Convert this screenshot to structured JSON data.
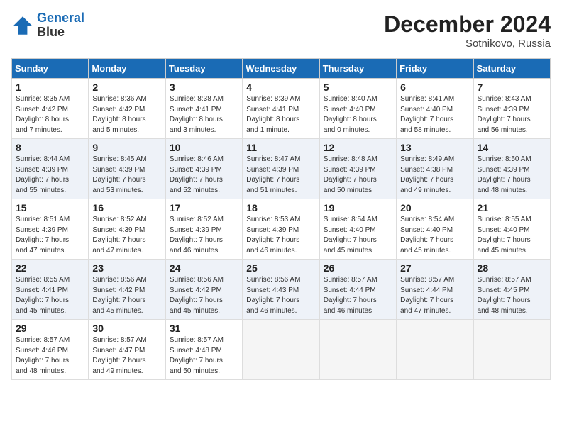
{
  "header": {
    "logo_line1": "General",
    "logo_line2": "Blue",
    "month": "December 2024",
    "location": "Sotnikovo, Russia"
  },
  "days_of_week": [
    "Sunday",
    "Monday",
    "Tuesday",
    "Wednesday",
    "Thursday",
    "Friday",
    "Saturday"
  ],
  "weeks": [
    [
      {
        "day": 1,
        "lines": [
          "Sunrise: 8:35 AM",
          "Sunset: 4:42 PM",
          "Daylight: 8 hours",
          "and 7 minutes."
        ]
      },
      {
        "day": 2,
        "lines": [
          "Sunrise: 8:36 AM",
          "Sunset: 4:42 PM",
          "Daylight: 8 hours",
          "and 5 minutes."
        ]
      },
      {
        "day": 3,
        "lines": [
          "Sunrise: 8:38 AM",
          "Sunset: 4:41 PM",
          "Daylight: 8 hours",
          "and 3 minutes."
        ]
      },
      {
        "day": 4,
        "lines": [
          "Sunrise: 8:39 AM",
          "Sunset: 4:41 PM",
          "Daylight: 8 hours",
          "and 1 minute."
        ]
      },
      {
        "day": 5,
        "lines": [
          "Sunrise: 8:40 AM",
          "Sunset: 4:40 PM",
          "Daylight: 8 hours",
          "and 0 minutes."
        ]
      },
      {
        "day": 6,
        "lines": [
          "Sunrise: 8:41 AM",
          "Sunset: 4:40 PM",
          "Daylight: 7 hours",
          "and 58 minutes."
        ]
      },
      {
        "day": 7,
        "lines": [
          "Sunrise: 8:43 AM",
          "Sunset: 4:39 PM",
          "Daylight: 7 hours",
          "and 56 minutes."
        ]
      }
    ],
    [
      {
        "day": 8,
        "lines": [
          "Sunrise: 8:44 AM",
          "Sunset: 4:39 PM",
          "Daylight: 7 hours",
          "and 55 minutes."
        ]
      },
      {
        "day": 9,
        "lines": [
          "Sunrise: 8:45 AM",
          "Sunset: 4:39 PM",
          "Daylight: 7 hours",
          "and 53 minutes."
        ]
      },
      {
        "day": 10,
        "lines": [
          "Sunrise: 8:46 AM",
          "Sunset: 4:39 PM",
          "Daylight: 7 hours",
          "and 52 minutes."
        ]
      },
      {
        "day": 11,
        "lines": [
          "Sunrise: 8:47 AM",
          "Sunset: 4:39 PM",
          "Daylight: 7 hours",
          "and 51 minutes."
        ]
      },
      {
        "day": 12,
        "lines": [
          "Sunrise: 8:48 AM",
          "Sunset: 4:39 PM",
          "Daylight: 7 hours",
          "and 50 minutes."
        ]
      },
      {
        "day": 13,
        "lines": [
          "Sunrise: 8:49 AM",
          "Sunset: 4:38 PM",
          "Daylight: 7 hours",
          "and 49 minutes."
        ]
      },
      {
        "day": 14,
        "lines": [
          "Sunrise: 8:50 AM",
          "Sunset: 4:39 PM",
          "Daylight: 7 hours",
          "and 48 minutes."
        ]
      }
    ],
    [
      {
        "day": 15,
        "lines": [
          "Sunrise: 8:51 AM",
          "Sunset: 4:39 PM",
          "Daylight: 7 hours",
          "and 47 minutes."
        ]
      },
      {
        "day": 16,
        "lines": [
          "Sunrise: 8:52 AM",
          "Sunset: 4:39 PM",
          "Daylight: 7 hours",
          "and 47 minutes."
        ]
      },
      {
        "day": 17,
        "lines": [
          "Sunrise: 8:52 AM",
          "Sunset: 4:39 PM",
          "Daylight: 7 hours",
          "and 46 minutes."
        ]
      },
      {
        "day": 18,
        "lines": [
          "Sunrise: 8:53 AM",
          "Sunset: 4:39 PM",
          "Daylight: 7 hours",
          "and 46 minutes."
        ]
      },
      {
        "day": 19,
        "lines": [
          "Sunrise: 8:54 AM",
          "Sunset: 4:40 PM",
          "Daylight: 7 hours",
          "and 45 minutes."
        ]
      },
      {
        "day": 20,
        "lines": [
          "Sunrise: 8:54 AM",
          "Sunset: 4:40 PM",
          "Daylight: 7 hours",
          "and 45 minutes."
        ]
      },
      {
        "day": 21,
        "lines": [
          "Sunrise: 8:55 AM",
          "Sunset: 4:40 PM",
          "Daylight: 7 hours",
          "and 45 minutes."
        ]
      }
    ],
    [
      {
        "day": 22,
        "lines": [
          "Sunrise: 8:55 AM",
          "Sunset: 4:41 PM",
          "Daylight: 7 hours",
          "and 45 minutes."
        ]
      },
      {
        "day": 23,
        "lines": [
          "Sunrise: 8:56 AM",
          "Sunset: 4:42 PM",
          "Daylight: 7 hours",
          "and 45 minutes."
        ]
      },
      {
        "day": 24,
        "lines": [
          "Sunrise: 8:56 AM",
          "Sunset: 4:42 PM",
          "Daylight: 7 hours",
          "and 45 minutes."
        ]
      },
      {
        "day": 25,
        "lines": [
          "Sunrise: 8:56 AM",
          "Sunset: 4:43 PM",
          "Daylight: 7 hours",
          "and 46 minutes."
        ]
      },
      {
        "day": 26,
        "lines": [
          "Sunrise: 8:57 AM",
          "Sunset: 4:44 PM",
          "Daylight: 7 hours",
          "and 46 minutes."
        ]
      },
      {
        "day": 27,
        "lines": [
          "Sunrise: 8:57 AM",
          "Sunset: 4:44 PM",
          "Daylight: 7 hours",
          "and 47 minutes."
        ]
      },
      {
        "day": 28,
        "lines": [
          "Sunrise: 8:57 AM",
          "Sunset: 4:45 PM",
          "Daylight: 7 hours",
          "and 48 minutes."
        ]
      }
    ],
    [
      {
        "day": 29,
        "lines": [
          "Sunrise: 8:57 AM",
          "Sunset: 4:46 PM",
          "Daylight: 7 hours",
          "and 48 minutes."
        ]
      },
      {
        "day": 30,
        "lines": [
          "Sunrise: 8:57 AM",
          "Sunset: 4:47 PM",
          "Daylight: 7 hours",
          "and 49 minutes."
        ]
      },
      {
        "day": 31,
        "lines": [
          "Sunrise: 8:57 AM",
          "Sunset: 4:48 PM",
          "Daylight: 7 hours",
          "and 50 minutes."
        ]
      },
      null,
      null,
      null,
      null
    ]
  ]
}
